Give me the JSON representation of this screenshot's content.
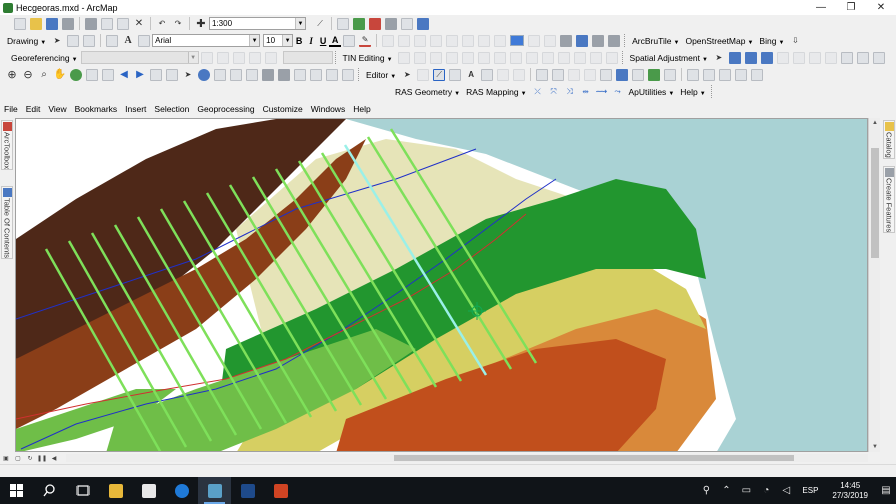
{
  "window": {
    "title": "Hecgeoras.mxd - ArcMap",
    "minimize": "—",
    "maximize": "❐",
    "close": "✕"
  },
  "toolbar1": {
    "scale": "1:300"
  },
  "toolbar2": {
    "drawing_label": "Drawing",
    "font_name": "Arial",
    "font_size": "10",
    "bold": "B",
    "italic": "I",
    "underline": "U",
    "font_color": "A",
    "arcbrutile": "ArcBruTile",
    "openstreetmap": "OpenStreetMap",
    "bing": "Bing"
  },
  "toolbar3": {
    "georeferencing": "Georeferencing",
    "tin_editing": "TIN Editing",
    "spatial_adjustment": "Spatial Adjustment"
  },
  "toolbar4": {
    "editor": "Editor"
  },
  "toolbar5": {
    "ras_geometry": "RAS Geometry",
    "ras_mapping": "RAS Mapping",
    "apputilities": "ApUtilities",
    "help": "Help"
  },
  "menu": [
    "File",
    "Edit",
    "View",
    "Bookmarks",
    "Insert",
    "Selection",
    "Geoprocessing",
    "Customize",
    "Windows",
    "Help"
  ],
  "left_dock": {
    "arctoolbox": "ArcToolbox",
    "table_of_contents": "Table Of Contents"
  },
  "right_dock": {
    "catalog": "Catalog",
    "create_features": "Create Features"
  },
  "map": {
    "colors": {
      "dark_brown": "#4e2818",
      "brown": "#8a3e18",
      "red_orange": "#c14f1c",
      "orange": "#d9893a",
      "yellow": "#d6cf62",
      "light_green": "#6fbe48",
      "green": "#22962f",
      "cream": "#e6e4b8",
      "light_blue": "#a9d2d4",
      "cross_section": "#7ee05a",
      "river_line": "#2030c8",
      "bank_line": "#d03030"
    }
  },
  "taskbar": {
    "language": "ESP",
    "time": "14:45",
    "date": "27/3/2019"
  }
}
